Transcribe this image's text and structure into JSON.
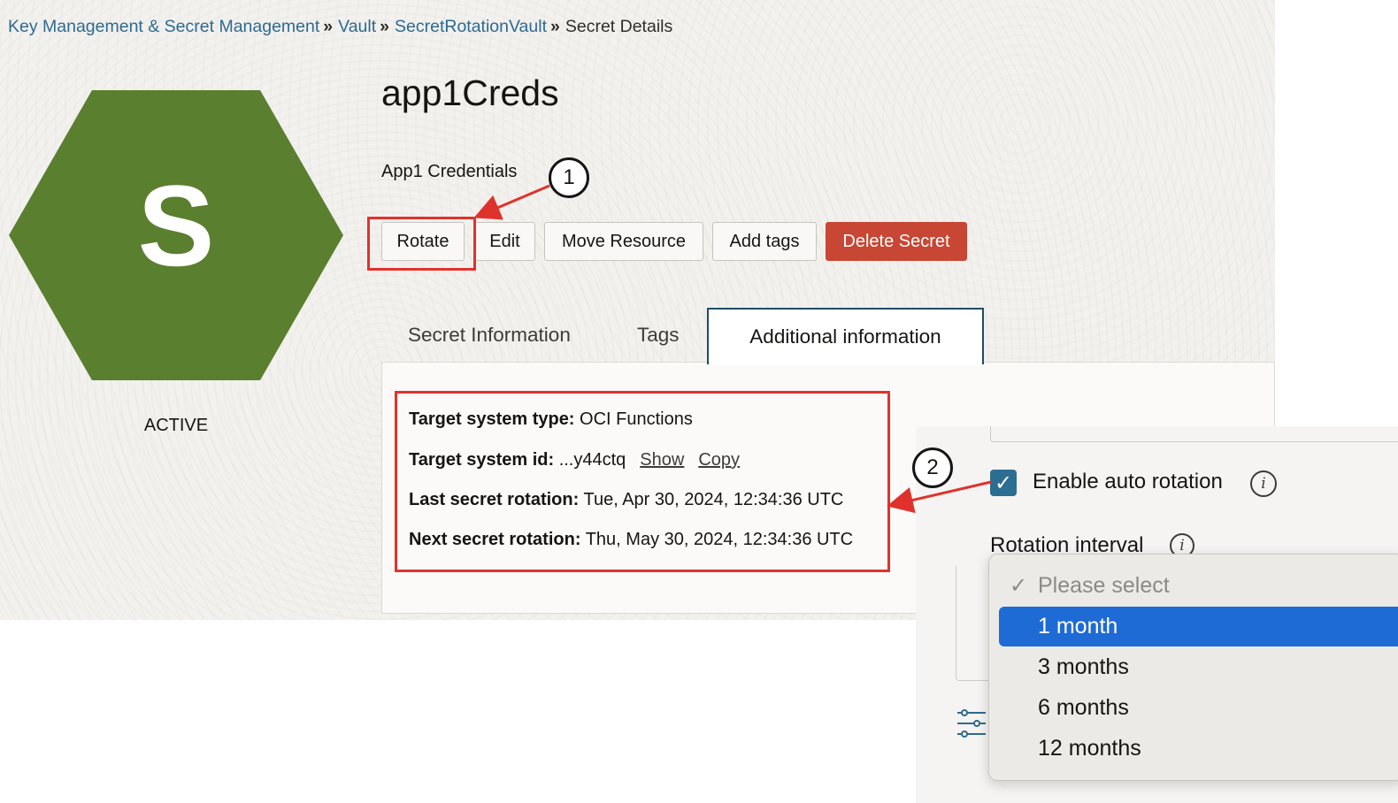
{
  "breadcrumb": {
    "items": [
      "Key Management & Secret Management",
      "Vault",
      "SecretRotationVault"
    ],
    "current": "Secret Details",
    "separator": "»"
  },
  "secret": {
    "icon_letter": "S",
    "icon_color": "#5a7f2f",
    "status": "ACTIVE",
    "name": "app1Creds",
    "description": "App1 Credentials"
  },
  "actions": {
    "rotate": "Rotate",
    "edit": "Edit",
    "move_resource": "Move Resource",
    "add_tags": "Add tags",
    "delete_secret": "Delete Secret"
  },
  "tabs": [
    "Secret Information",
    "Tags",
    "Additional information"
  ],
  "active_tab": "Additional information",
  "additional_info": {
    "target_type_label": "Target system type:",
    "target_type_value": "OCI Functions",
    "target_id_label": "Target system id:",
    "target_id_value": "...y44ctq",
    "show_link": "Show",
    "copy_link": "Copy",
    "last_rotation_label": "Last secret rotation:",
    "last_rotation_value": "Tue, Apr 30, 2024, 12:34:36 UTC",
    "next_rotation_label": "Next secret rotation:",
    "next_rotation_value": "Thu, May 30, 2024, 12:34:36 UTC"
  },
  "callouts": [
    "1",
    "2"
  ],
  "rotation_panel": {
    "enable_label": "Enable auto rotation",
    "enable_checked": true,
    "interval_label": "Rotation interval",
    "info_icon": "i",
    "check_glyph": "✓",
    "options": [
      "Please select",
      "1 month",
      "3 months",
      "6 months",
      "12 months"
    ],
    "selected": "1 month"
  },
  "colors": {
    "accent_red": "#e0322c",
    "danger_button": "#c74634",
    "link": "#2e6a8f",
    "selected_option": "#1f6bd6",
    "checkbox": "#2c6e91"
  }
}
